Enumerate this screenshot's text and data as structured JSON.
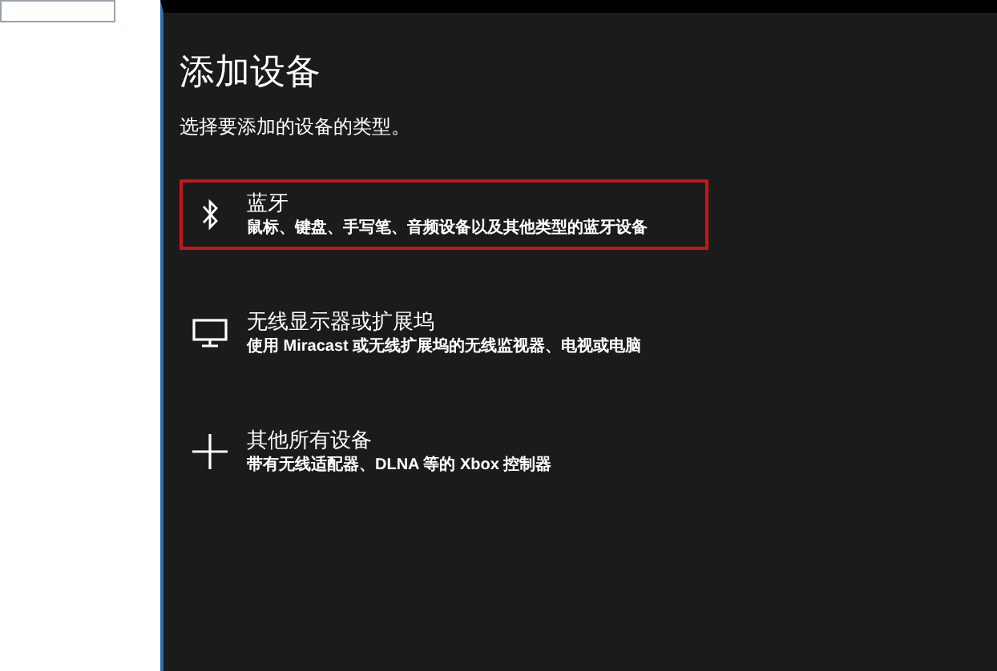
{
  "title": "添加设备",
  "subtitle": "选择要添加的设备的类型。",
  "device_types": [
    {
      "kind": "bluetooth",
      "name": "蓝牙",
      "description": "鼠标、键盘、手写笔、音频设备以及其他类型的蓝牙设备",
      "selected": true
    },
    {
      "kind": "display",
      "name": "无线显示器或扩展坞",
      "description": "使用 Miracast 或无线扩展坞的无线监视器、电视或电脑",
      "selected": false
    },
    {
      "kind": "other",
      "name": "其他所有设备",
      "description": "带有无线适配器、DLNA 等的 Xbox 控制器",
      "selected": false
    }
  ]
}
